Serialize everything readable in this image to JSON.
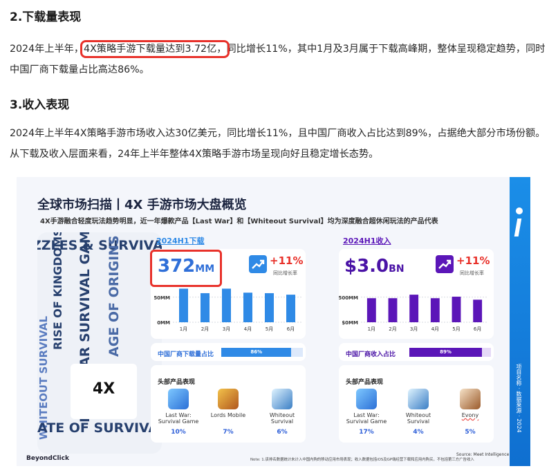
{
  "section2": {
    "heading": "2.下载量表现",
    "para_pre": "2024年上半年，",
    "para_highlight": "4X策略手游下载量达到3.72亿，",
    "para_post": "同比增长11%，其中1月及3月属于下载高峰期，整体呈现稳定趋势，同时中国厂商下载量占比高达86%。"
  },
  "section3": {
    "heading": "3.收入表现",
    "para": "2024年上半年4X策略手游市场收入达30亿美元，同比增长11%，且中国厂商收入占比达到89%，占据绝大部分市场份额。从下载及收入层面来看，24年上半年整体4X策略手游市场呈现向好且稳定增长态势。"
  },
  "infographic": {
    "title": "全球市场扫描丨4X 手游市场大盘概览",
    "subtitle": "4X手游融合轻度玩法趋势明显，近一年爆款产品【Last War】和【Whiteout Survival】均为深度融合超休闲玩法的产品代表",
    "collage_texts": [
      "ZZLES & SURVIVA",
      "RISE OF KINGDOMS",
      "LAST WAR SURVIVAL GAME",
      "AGE OF ORIGINS",
      "WHITEOUT SURVIVAL",
      "ATE OF SURVIVAL"
    ],
    "collage_label": "4X",
    "stripe_text": "项目名称 · 数据来源 · 2024",
    "footer_brand": "BeyondClick",
    "footer_note": "Note: 1.该排名数据统计未计入中国内购的移动应用市场表现；收入数据包括iOS及GP端经营下载和应用内购买，不包括第三方广告收入",
    "source": "Source: Meet Intelligence",
    "downloads": {
      "tag": "2024H1下载",
      "value": "372",
      "unit": "MM",
      "growth": "+11%",
      "growth_label": "同比增长率",
      "share_label": "中国厂商下载量占比",
      "share_value": "86%",
      "top_label": "头部产品表现",
      "top_games": [
        {
          "name": "Last War:\nSurvival Game",
          "pct": "10%"
        },
        {
          "name": "Lords Mobile",
          "pct": "7%"
        },
        {
          "name": "Whiteout\nSurvival",
          "pct": "6%"
        }
      ]
    },
    "revenue": {
      "tag": "2024H1收入",
      "value": "$3.0",
      "unit": "BN",
      "growth": "+11%",
      "growth_label": "同比增长率",
      "share_label": "中国厂商收入占比",
      "share_value": "89%",
      "top_label": "头部产品表现",
      "top_games": [
        {
          "name": "Last War:\nSurvival Game",
          "pct": "17%"
        },
        {
          "name": "Whiteout\nSurvival",
          "pct": "4%"
        },
        {
          "name": "Evony",
          "pct": "5%"
        }
      ]
    },
    "colors": {
      "downloads": "#2f8ae6",
      "revenue": "#5b16b8",
      "accent_red": "#e8312a"
    }
  },
  "chart_data": [
    {
      "type": "bar",
      "title": "2024H1下载",
      "categories": [
        "1月",
        "2月",
        "3月",
        "4月",
        "5月",
        "6月"
      ],
      "values": [
        67,
        58,
        67,
        59,
        58,
        55
      ],
      "ytick_labels": [
        "50MM",
        "0MM"
      ],
      "yticks": [
        50,
        0
      ],
      "ylim": [
        0,
        80
      ]
    },
    {
      "type": "bar",
      "title": "2024H1收入",
      "categories": [
        "1月",
        "2月",
        "3月",
        "4月",
        "5月",
        "6月"
      ],
      "values": [
        480,
        480,
        550,
        480,
        510,
        450
      ],
      "ytick_labels": [
        "$500MM",
        "$0MM"
      ],
      "yticks": [
        500,
        0
      ],
      "ylim": [
        0,
        800
      ]
    }
  ]
}
